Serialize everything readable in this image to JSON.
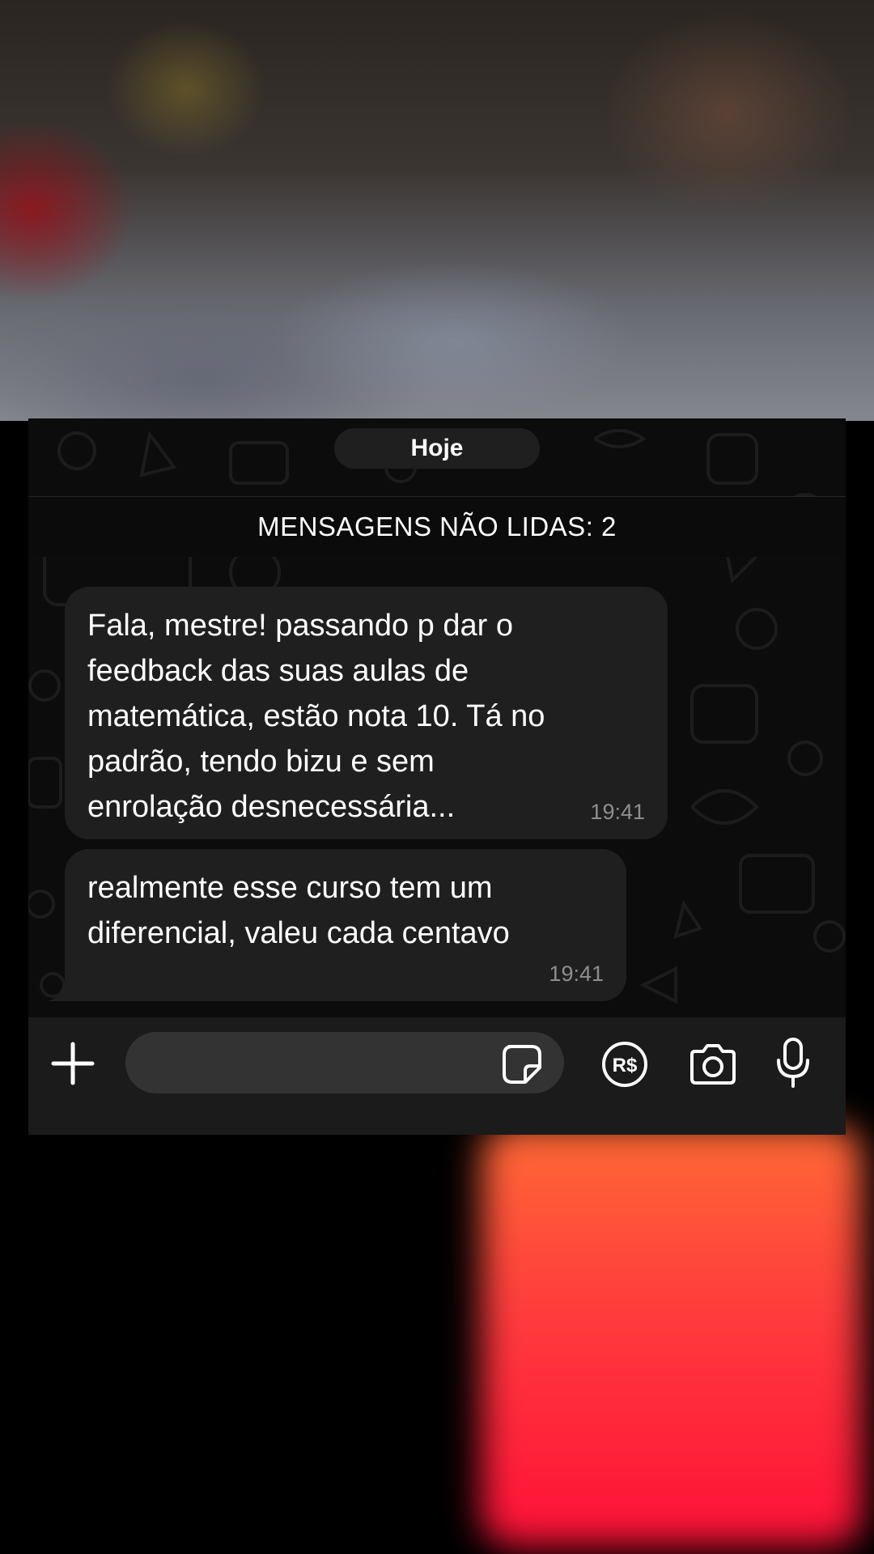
{
  "chat": {
    "date_label": "Hoje",
    "unread_banner": "MENSAGENS NÃO LIDAS: 2",
    "messages": [
      {
        "text": "Fala, mestre! passando p dar o\nfeedback das suas aulas de\nmatemática, estão nota 10. Tá no\npadrão, tendo bizu e sem\nenrolação desnecessária...",
        "time": "19:41"
      },
      {
        "text": "realmente esse curso tem um\ndiferencial, valeu cada centavo",
        "time": "19:41"
      }
    ]
  },
  "input_bar": {
    "message_value": "",
    "icons": [
      "plus-icon",
      "sticker-icon",
      "payment-icon",
      "camera-icon",
      "microphone-icon"
    ],
    "payment_symbol": "R$"
  },
  "colors": {
    "chat_background": "#0c0c0c",
    "bubble": "#1f1f1f",
    "input_bar": "#1b1b1b",
    "text_field": "#333333",
    "timestamp": "#8e8e8e"
  }
}
